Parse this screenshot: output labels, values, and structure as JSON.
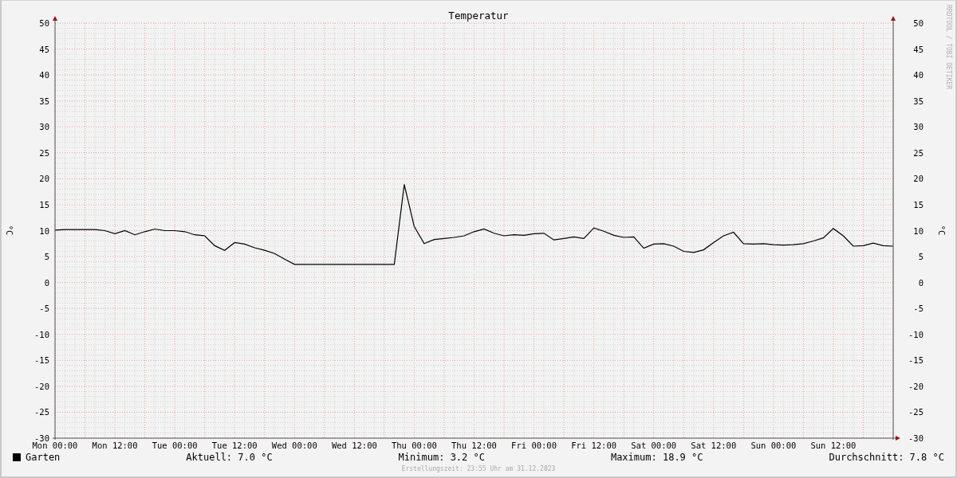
{
  "title": "Temperatur",
  "credit": "RRDTOOL / TOBI OETIKER",
  "chart_data": {
    "type": "line",
    "ylabel": "°C",
    "categories": [
      "Mon 00:00",
      null,
      null,
      null,
      null,
      null,
      "Mon 12:00",
      null,
      null,
      null,
      null,
      null,
      "Tue 00:00",
      null,
      null,
      null,
      null,
      null,
      "Tue 12:00",
      null,
      null,
      null,
      null,
      null,
      "Wed 00:00",
      null,
      null,
      null,
      null,
      null,
      "Wed 12:00",
      null,
      null,
      null,
      null,
      null,
      "Thu 00:00",
      null,
      null,
      null,
      null,
      null,
      "Thu 12:00",
      null,
      null,
      null,
      null,
      null,
      "Fri 00:00",
      null,
      null,
      null,
      null,
      null,
      "Fri 12:00",
      null,
      null,
      null,
      null,
      null,
      "Sat 00:00",
      null,
      null,
      null,
      null,
      null,
      "Sat 12:00",
      null,
      null,
      null,
      null,
      null,
      "Sun 00:00",
      null,
      null,
      null,
      null,
      null,
      "Sun 12:00",
      null,
      null,
      null,
      null,
      null,
      null
    ],
    "series": [
      {
        "name": "Garten",
        "color": "#000000",
        "values": [
          10.1,
          10.2,
          10.2,
          10.2,
          10.2,
          10.0,
          9.4,
          10.0,
          9.2,
          9.8,
          10.3,
          10.0,
          10.0,
          9.8,
          9.2,
          9.0,
          7.1,
          6.2,
          7.7,
          7.4,
          6.7,
          6.2,
          5.6,
          4.5,
          3.5,
          3.5,
          3.5,
          3.5,
          3.5,
          3.5,
          3.5,
          3.5,
          3.5,
          3.5,
          3.5,
          18.9,
          10.8,
          7.5,
          8.3,
          8.5,
          8.7,
          9.0,
          9.8,
          10.3,
          9.5,
          9.0,
          9.2,
          9.1,
          9.4,
          9.5,
          8.2,
          8.5,
          8.8,
          8.5,
          10.5,
          9.9,
          9.1,
          8.7,
          8.8,
          6.6,
          7.4,
          7.5,
          7.0,
          6.0,
          5.8,
          6.3,
          7.7,
          9.0,
          9.7,
          7.5,
          7.4,
          7.5,
          7.3,
          7.2,
          7.3,
          7.5,
          8.0,
          8.6,
          10.4,
          9.0,
          7.0,
          7.1,
          7.6,
          7.1,
          7.0
        ]
      }
    ],
    "grid": true,
    "ylim": [
      -30,
      50
    ],
    "yticks": [
      -30,
      -25,
      -20,
      -15,
      -10,
      -5,
      0,
      5,
      10,
      15,
      20,
      25,
      30,
      35,
      40,
      45,
      50
    ]
  },
  "right_axis": {
    "label": "°C",
    "ticks": [
      "50",
      "45",
      "40",
      "35",
      "30",
      "25",
      "20",
      "15",
      "10",
      "5",
      "0",
      "-5",
      "-10",
      "-15",
      "-20",
      "-25",
      "-30"
    ]
  },
  "legend": {
    "stats": [
      "Aktuell: 7.0 °C",
      "Minimum: 3.2 °C",
      "Maximum: 18.9 °C",
      "Durchschnitt: 7.8 °C"
    ]
  },
  "footer": "Erstellungszeit: 23:55 Uhr am 31.12.2023"
}
